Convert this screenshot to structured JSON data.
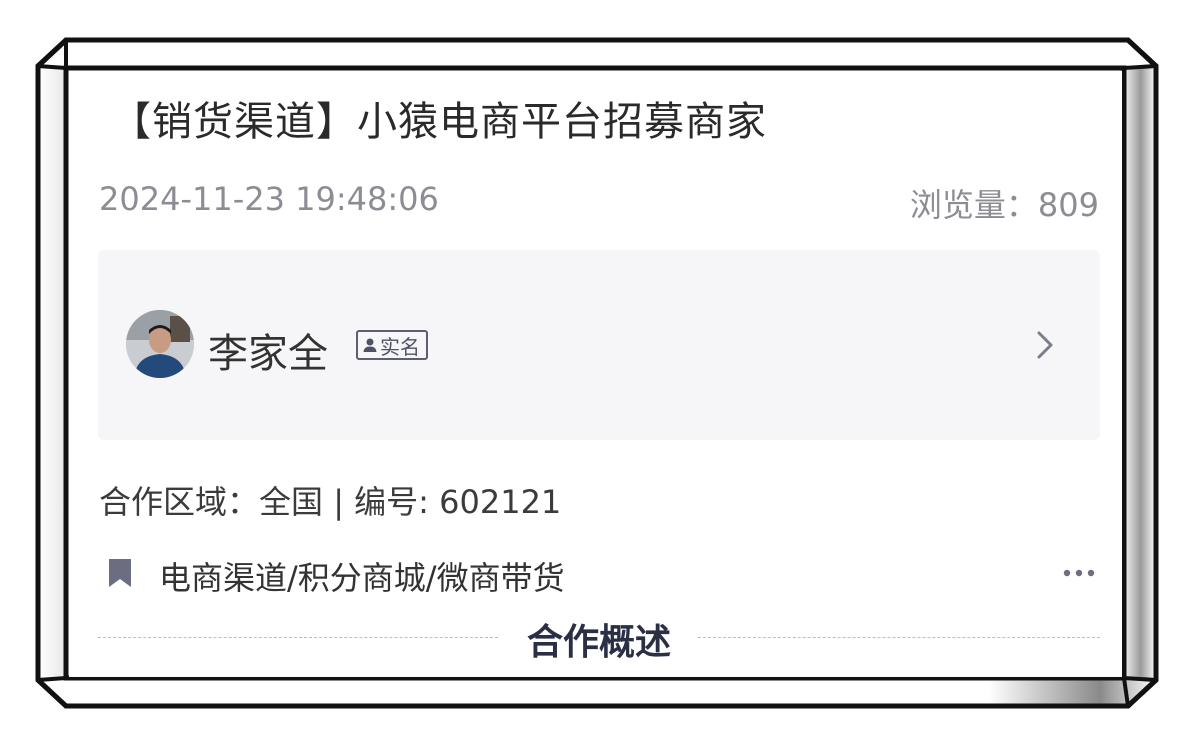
{
  "post": {
    "title": "【销货渠道】小猿电商平台招募商家",
    "datetime": "2024-11-23 19:48:06",
    "views_label": "浏览量：",
    "views_count": "809"
  },
  "author": {
    "name": "李家全",
    "badge_label": "实名",
    "avatar_icon": "user-avatar-photo",
    "badge_icon": "person-icon",
    "chevron_icon": "chevron-right-icon"
  },
  "details": {
    "region_label": "合作区域：",
    "region_value": "全国",
    "separator": " | ",
    "number_label": "编号: ",
    "number_value": "602121"
  },
  "tags": {
    "icon": "bookmark-icon",
    "text": "电商渠道/积分商城/微商带货",
    "more_icon": "more-dots-icon"
  },
  "section": {
    "title": "合作概述"
  },
  "colors": {
    "text_primary": "#2a2a2a",
    "text_meta": "#8c8c94",
    "author_bg": "#f6f6f9",
    "accent_dark": "#2b2f45",
    "icon_gray": "#6b6e80"
  }
}
